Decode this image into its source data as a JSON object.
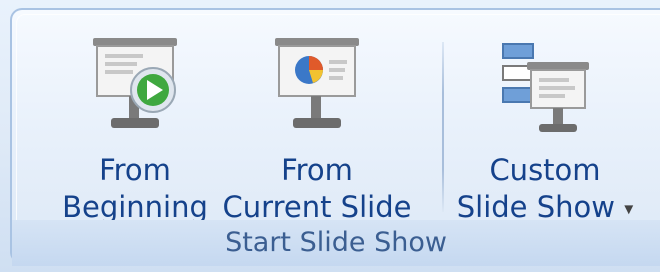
{
  "ribbon_group": {
    "label": "Start Slide Show",
    "buttons": [
      {
        "line1": "From",
        "line2": "Beginning",
        "icon": "play-slideshow-icon"
      },
      {
        "line1": "From",
        "line2": "Current Slide",
        "icon": "current-slide-icon"
      },
      {
        "line1": "Custom",
        "line2": "Slide Show",
        "icon": "custom-slideshow-icon",
        "dropdown": "▾"
      }
    ]
  }
}
